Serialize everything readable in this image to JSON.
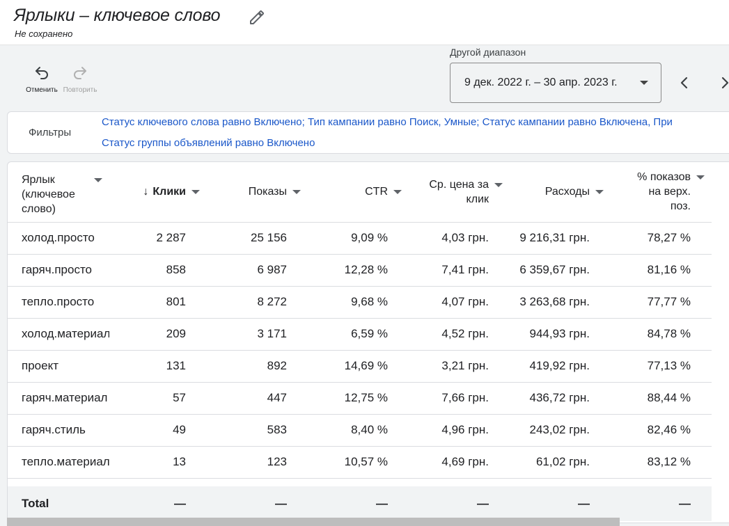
{
  "header": {
    "title": "Ярлыки – ключевое слово",
    "subtitle": "Не сохранено"
  },
  "toolbar": {
    "undo_label": "Отменить",
    "redo_label": "Повторить"
  },
  "date_range": {
    "caption": "Другой диапазон",
    "value": "9 дек. 2022 г. – 30 апр. 2023 г."
  },
  "filters": {
    "label": "Фильтры",
    "line1": "Статус ключевого слова равно Включено; Тип кампании равно Поиск, Умные; Статус кампании равно Включена, При",
    "line2": "Статус группы объявлений равно Включено"
  },
  "table": {
    "columns": {
      "keyword": "Ярлык (ключевое слово)",
      "clicks": "Клики",
      "impressions": "Показы",
      "ctr": "CTR",
      "cpc": "Ср. цена за клик",
      "cost": "Расходы",
      "top_share": "% показов на верх. поз."
    },
    "rows": [
      {
        "keyword": "холод.просто",
        "clicks": "2 287",
        "impressions": "25 156",
        "ctr": "9,09 %",
        "cpc": "4,03 грн.",
        "cost": "9 216,31 грн.",
        "top_share": "78,27 %"
      },
      {
        "keyword": "гаряч.просто",
        "clicks": "858",
        "impressions": "6 987",
        "ctr": "12,28 %",
        "cpc": "7,41 грн.",
        "cost": "6 359,67 грн.",
        "top_share": "81,16 %"
      },
      {
        "keyword": "тепло.просто",
        "clicks": "801",
        "impressions": "8 272",
        "ctr": "9,68 %",
        "cpc": "4,07 грн.",
        "cost": "3 263,68 грн.",
        "top_share": "77,77 %"
      },
      {
        "keyword": "холод.материал",
        "clicks": "209",
        "impressions": "3 171",
        "ctr": "6,59 %",
        "cpc": "4,52 грн.",
        "cost": "944,93 грн.",
        "top_share": "84,78 %"
      },
      {
        "keyword": "проект",
        "clicks": "131",
        "impressions": "892",
        "ctr": "14,69 %",
        "cpc": "3,21 грн.",
        "cost": "419,92 грн.",
        "top_share": "77,13 %"
      },
      {
        "keyword": "гаряч.материал",
        "clicks": "57",
        "impressions": "447",
        "ctr": "12,75 %",
        "cpc": "7,66 грн.",
        "cost": "436,72 грн.",
        "top_share": "88,44 %"
      },
      {
        "keyword": "гаряч.стиль",
        "clicks": "49",
        "impressions": "583",
        "ctr": "8,40 %",
        "cpc": "4,96 грн.",
        "cost": "243,02 грн.",
        "top_share": "82,46 %"
      },
      {
        "keyword": "тепло.материал",
        "clicks": "13",
        "impressions": "123",
        "ctr": "10,57 %",
        "cpc": "4,69 грн.",
        "cost": "61,02 грн.",
        "top_share": "83,12 %"
      }
    ],
    "total": {
      "label": "Total",
      "clicks": "—",
      "impressions": "—",
      "ctr": "—",
      "cpc": "—",
      "cost": "—",
      "top_share": "—"
    }
  },
  "colors": {
    "filter_link": "#1a57c9",
    "background": "#f1f3f4"
  },
  "icons": [
    "pencil-icon",
    "undo-icon",
    "redo-icon",
    "dropdown-caret-icon",
    "chevron-left-icon",
    "chevron-right-icon",
    "sort-caret-icon",
    "arrow-down-icon"
  ]
}
